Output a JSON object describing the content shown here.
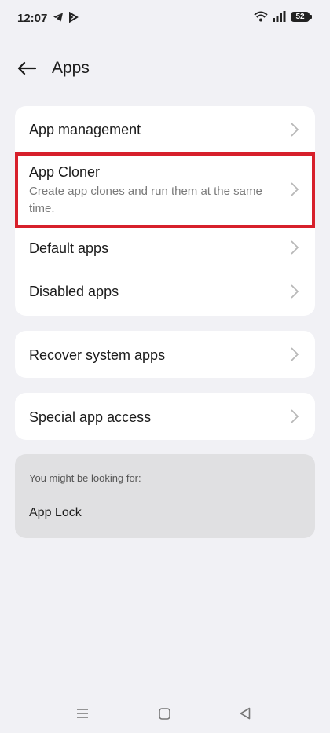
{
  "status_bar": {
    "time": "12:07",
    "battery": "52"
  },
  "header": {
    "title": "Apps"
  },
  "group1": {
    "items": [
      {
        "title": "App management"
      },
      {
        "title": "App Cloner",
        "subtitle": "Create app clones and run them at the same time."
      },
      {
        "title": "Default apps"
      },
      {
        "title": "Disabled apps"
      }
    ]
  },
  "group2": {
    "title": "Recover system apps"
  },
  "group3": {
    "title": "Special app access"
  },
  "suggest": {
    "label": "You might be looking for:",
    "item": "App Lock"
  },
  "colors": {
    "highlight": "#d7202b",
    "background": "#f1f1f5",
    "card": "#ffffff"
  }
}
